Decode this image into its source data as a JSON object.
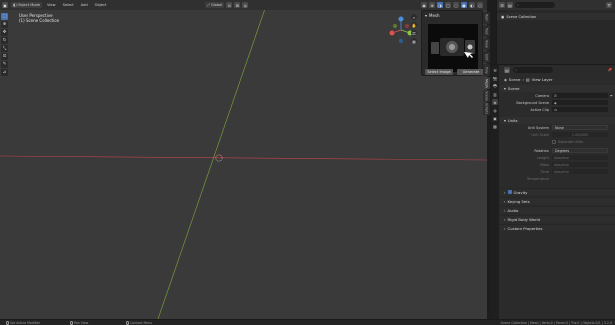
{
  "viewport": {
    "header": {
      "mode": "Object Mode",
      "menus": [
        "View",
        "Select",
        "Add",
        "Object"
      ],
      "transform": "Global"
    },
    "info_line1": "User Perspective",
    "info_line2": "(1) Scene Collection",
    "axis_colors": {
      "x": "#d9534f",
      "y": "#8ac34a",
      "z": "#4a8fd9"
    },
    "background": "#3a3a3a"
  },
  "mesh_panel": {
    "title": "Mesh",
    "button_left": "Select Image",
    "button_right": "Generate"
  },
  "n_tabs": [
    "Item",
    "Tool",
    "View",
    "Edit",
    "Poly",
    "Mesh",
    "Scene",
    "Scripts"
  ],
  "outliner": {
    "row_label": "Scene Collection"
  },
  "properties": {
    "breadcrumb": [
      "Scene",
      "View Layer"
    ],
    "scene": {
      "title": "Scene",
      "camera_label": "Camera",
      "background_label": "Background Scene",
      "active_clip_label": "Active Clip"
    },
    "units": {
      "title": "Units",
      "unit_system_label": "Unit System",
      "unit_system_value": "None",
      "unit_scale_label": "Unit Scale",
      "unit_scale_value": "1.000000",
      "separate_label": "Separate Units",
      "rotation_label": "Rotation",
      "rotation_value": "Degrees",
      "length_label": "Length",
      "length_value": "Adaptive",
      "mass_label": "Mass",
      "mass_value": "Adaptive",
      "time_label": "Time",
      "time_value": "Adaptive",
      "temperature_label": "Temperature"
    },
    "collapsed": [
      "Gravity",
      "Keying Sets",
      "Audio",
      "Rigid Body World",
      "Custom Properties"
    ]
  },
  "statusbar": {
    "left": "Set Active Modifier",
    "mid1": "Pan View",
    "mid2": "Context Menu",
    "right": "Scene Collection | Mesh | Verts:0 | Faces:0 | Tris:0 | Objects:0/1 | 3.2.0"
  }
}
